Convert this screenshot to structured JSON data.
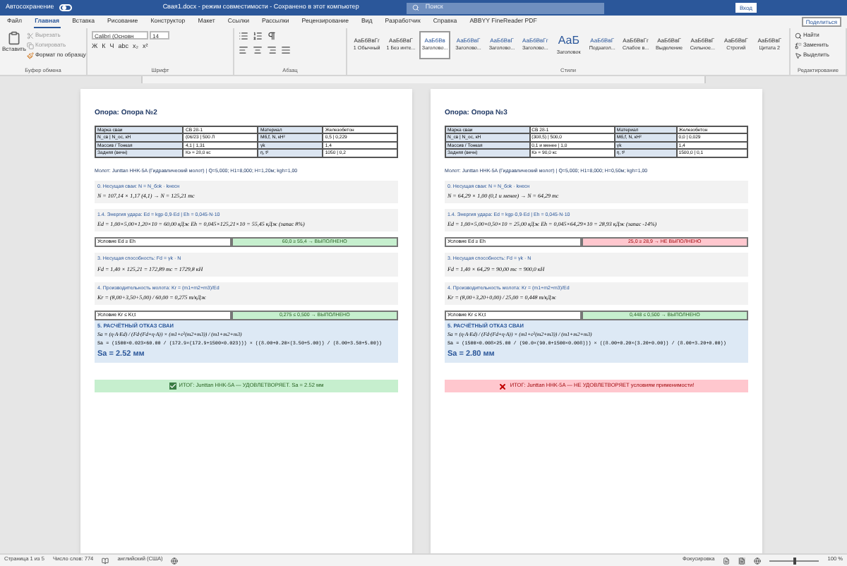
{
  "title_bar": {
    "autosave_label": "Автосохранение",
    "autosave_on": false,
    "document_title": "Свая1.docx - режим совместимости - Сохранено в этот компьютер",
    "search_placeholder": "Поиск",
    "sign_in": "Вход"
  },
  "menu_tabs": [
    {
      "label": "Файл",
      "selected": false
    },
    {
      "label": "Главная",
      "selected": true
    },
    {
      "label": "Вставка",
      "selected": false
    },
    {
      "label": "Рисование",
      "selected": false
    },
    {
      "label": "Конструктор",
      "selected": false
    },
    {
      "label": "Макет",
      "selected": false
    },
    {
      "label": "Ссылки",
      "selected": false
    },
    {
      "label": "Рассылки",
      "selected": false
    },
    {
      "label": "Рецензирование",
      "selected": false
    },
    {
      "label": "Вид",
      "selected": false
    },
    {
      "label": "Разработчик",
      "selected": false
    },
    {
      "label": "Справка",
      "selected": false
    },
    {
      "label": "ABBYY FineReader PDF",
      "selected": false
    }
  ],
  "share": "Поделиться",
  "clipboard": {
    "paste": "Вставить",
    "cut": "Вырезать",
    "copy": "Копировать",
    "format_painter": "Формат по образцу",
    "group": "Буфер обмена"
  },
  "font": {
    "name": "Calibri (Основн",
    "size": "14",
    "buttons": [
      "Ж",
      "К",
      "Ч",
      "abc",
      "x₂",
      "x²"
    ],
    "group": "Шрифт"
  },
  "paragraph": {
    "group": "Абзац"
  },
  "styles": {
    "group": "Стили",
    "items": [
      {
        "preview": "АаБбВвГг",
        "label": "1 Обычный",
        "selected": false
      },
      {
        "preview": "АаБбВвГ",
        "label": "1 Без инте...",
        "selected": false
      },
      {
        "preview": "АаБбВв",
        "label": "Заголово...",
        "selected": true
      },
      {
        "preview": "АаБбВвГ",
        "label": "Заголово...",
        "selected": false
      },
      {
        "preview": "АаБбВвГ",
        "label": "Заголово...",
        "selected": false
      },
      {
        "preview": "АаБбВвГг",
        "label": "Заголово...",
        "selected": false
      },
      {
        "preview": "АаБ",
        "label": "Заголовок",
        "selected": false
      },
      {
        "preview": "АаБбВвГ",
        "label": "Подзагол...",
        "selected": false
      },
      {
        "preview": "АаБбВвГг",
        "label": "Слабое в...",
        "selected": false
      },
      {
        "preview": "АаБбВвГ",
        "label": "Выделение",
        "selected": false
      },
      {
        "preview": "АаБбВвГ",
        "label": "Сильное...",
        "selected": false
      },
      {
        "preview": "АаБбВвГ",
        "label": "Строгий",
        "selected": false
      },
      {
        "preview": "АаБбВвГ",
        "label": "Цитата 2",
        "selected": false
      }
    ]
  },
  "editing": {
    "find": "Найти",
    "replace": "Заменить",
    "select": "Выделить",
    "group": "Редактирование"
  },
  "pages": [
    {
      "title": "Опора: Опора №2",
      "table": [
        [
          "Марка сваи",
          "СВ 28-1",
          "Материал",
          "Железобетон"
        ],
        [
          "N_св | N_ос, кН",
          "(06/23 | 500 Л",
          "Мб,f, N, кН²",
          "0,5 | 0,229"
        ],
        [
          "Массив / Тонкая",
          "4,1 | 1,31",
          "γk",
          "1,4"
        ],
        [
          "Задняя (вечн)",
          "Кэ = 28,0 кс",
          "η, t²",
          "1050 | 0,2"
        ]
      ],
      "hammer": "Молот: Junttan HHK-5A (Гидравлический молот)  |  Q=5,000; H1=8,000; H=1,20м; kgh=1,00",
      "steps": [
        {
          "kind": "box",
          "heading": "0. Несущая сваи: N = N_боk · kнесн",
          "formula": "N = 107,14 × 1,17 (4,1)  →  N = 125,21 тс"
        },
        {
          "kind": "box",
          "heading": "1.4. Энергия удара: Ed = kgp·0,9·Ed  |  Eh = 0,045·N·10",
          "formula": "Ed = 1,00×5,00×1,20×10 = 60,00 кДж   Eh = 0,045×125,21×10 = 55,45 кДж  (запас 8%)"
        },
        {
          "kind": "condition",
          "label": "Условие Ed ≥ Eh",
          "result": "60,0 ≥ 55,4 → ВЫПОЛНЕНО",
          "ok": true
        },
        {
          "kind": "box",
          "heading": "3. Несущая способность: Fd = γk · N",
          "formula": "Fd = 1,40 × 125,21 = 172,89 тс = 1729,8 кН"
        },
        {
          "kind": "box",
          "heading": "4. Производительность молота: Kr = (m1+m2+m3)/Ed",
          "formula": "Kr = (8,00+3,50+5,00) / 60,00 = 0,275 т/кДж"
        },
        {
          "kind": "condition",
          "label": "Условие Kr ≤ Kr,t",
          "result": "0,275 ≤ 0,500 → ВЫПОЛНЕНО",
          "ok": true
        }
      ],
      "calc": {
        "heading": "5. РАСЧЁТНЫЙ ОТКАЗ СВАИ",
        "formula": "Sa = (η·A·Ed) / (Fd·(Fd+η·A)) × (m1+ε$^{2}$(m2+m3)) / (m1+m2+m3)",
        "expanded": "Sa = (1500×0.023×60.00 / (172.9×(172.9+1500×0.023))) × ((8.00+0.20×(3.50+5.00)) / (8.00+3.50+5.00))",
        "result": "Sa = 2.52 мм"
      },
      "verdict": {
        "text": "ИТОГ: Junttan HHK-5A — УДОВЛЕТВОРЯЕТ. Sa = 2.52 мм",
        "ok": true
      }
    },
    {
      "title": "Опора: Опора №3",
      "table": [
        [
          "Марка сваи",
          "СВ 28-1",
          "Материал",
          "Железобетон"
        ],
        [
          "N_св | N_ос, кН",
          "(308,5) | 500,0",
          "Мб,f, N, кН²",
          "0,0 | 0,029"
        ],
        [
          "Массив / Тонкая",
          "0,1 и менее | 1,0",
          "γk",
          "1,4"
        ],
        [
          "Задняя (вечн)",
          "Кэ = 90,0 кс",
          "η, t²",
          "1500,0 | 0,1"
        ]
      ],
      "hammer": "Молот: Junttan HHK-5A (Гидравлический молот)  |  Q=5,000; H1=8,000; H=0,50м; kgh=1,00",
      "steps": [
        {
          "kind": "box",
          "heading": "0. Несущая сваи: N = N_боk · kнесн",
          "formula": "N = 64,29 × 1,00 (0,1 и менее)  →  N = 64,29 тс"
        },
        {
          "kind": "box",
          "heading": "1.4. Энергия удара: Ed = kgp·0,9·Ed  |  Eh = 0,045·N·10",
          "formula": "Ed = 1,00×5,00×0,50×10 = 25,00 кДж   Eh = 0,045×64,29×10 = 28,93 кДж  (запас -14%)"
        },
        {
          "kind": "condition",
          "label": "Условие Ed ≥ Eh",
          "result": "25,0 ≥ 28,9 → НЕ ВЫПОЛНЕНО",
          "ok": false
        },
        {
          "kind": "box",
          "heading": "3. Несущая способность: Fd = γk · N",
          "formula": "Fd = 1,40 × 64,29 = 90,00 тс = 900,0 кН"
        },
        {
          "kind": "box",
          "heading": "4. Производительность молота: Kr = (m1+m2+m3)/Ed",
          "formula": "Kr = (8,00+3,20+0,00) / 25,00 = 0,448 т/кДж"
        },
        {
          "kind": "condition",
          "label": "Условие Kr ≤ Kr,t",
          "result": "0,448 ≤ 0,500 → ВЫПОЛНЕНО",
          "ok": true
        }
      ],
      "calc": {
        "heading": "5. РАСЧЁТНЫЙ ОТКАЗ СВАИ",
        "formula": "Sa = (η·A·Ed) / (Fd·(Fd+η·A)) × (m1+ε$^{2}$(m2+m3)) / (m1+m2+m3)",
        "expanded": "Sa = (1500×0.008×25.00 / (90.0×(90.0+1500×0.008))) × ((8.00+0.20×(3.20+0.00)) / (8.00+3.20+0.00))",
        "result": "Sa = 2.80 мм"
      },
      "verdict": {
        "text": "ИТОГ: Junttan HHK-5A — НЕ УДОВЛЕТВОРЯЕТ условиям применимости!",
        "ok": false
      }
    }
  ],
  "status_bar": {
    "page": "Страница 1 из 5",
    "words": "Число слов: 774",
    "language": "английский (США)",
    "focus": "Фокусировка",
    "zoom": "100 %",
    "zoom_slider": {
      "level": 0.5
    }
  }
}
